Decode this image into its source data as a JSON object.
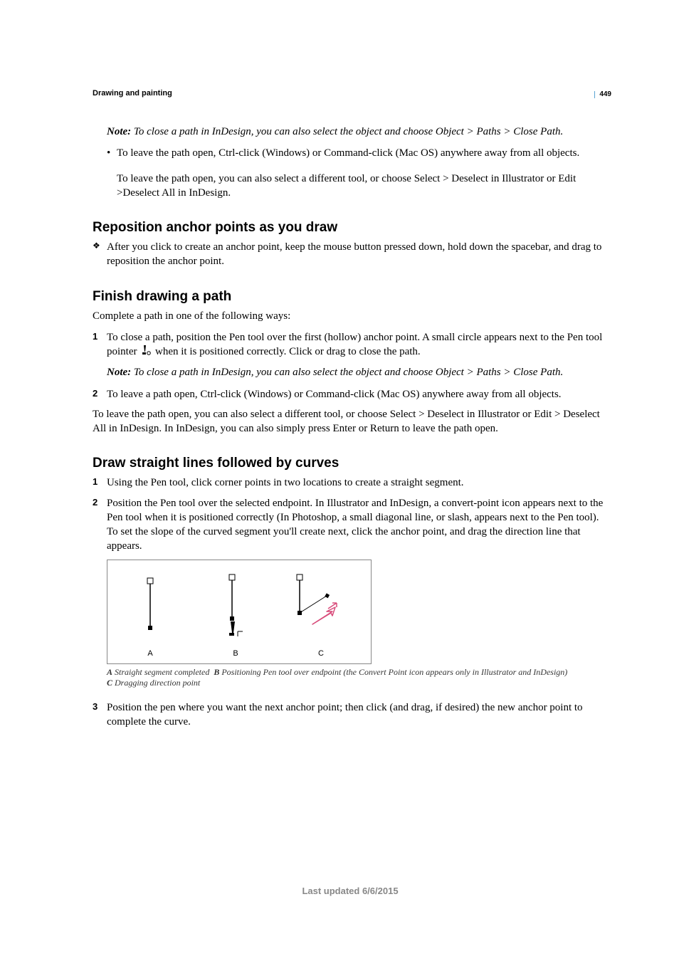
{
  "page_number": "449",
  "breadcrumb": "Drawing and painting",
  "intro_note": "To close a path in InDesign, you can also select the object and choose Object > Paths > Close Path.",
  "note_label": "Note: ",
  "bullet1": "To leave the path open, Ctrl-click (Windows) or Command-click (Mac OS) anywhere away from all objects.",
  "bullet1_sub": "To leave the path open, you can also select a different tool, or choose Select > Deselect in Illustrator or Edit >Deselect All in InDesign.",
  "sec1": {
    "title": "Reposition anchor points as you draw",
    "item": "After you click to create an anchor point, keep the mouse button pressed down, hold down the spacebar, and drag to reposition the anchor point."
  },
  "sec2": {
    "title": "Finish drawing a path",
    "intro": "Complete a path in one of the following ways:",
    "step1a": "To close a path, position the Pen tool over the first (hollow) anchor point. A small circle appears next to the Pen tool pointer ",
    "step1b": " when it is positioned correctly. Click or drag to close the path.",
    "note": "To close a path in InDesign, you can also select the object and choose Object > Paths > Close Path.",
    "step2": "To leave a path open, Ctrl-click (Windows) or Command-click (Mac OS) anywhere away from all objects.",
    "tail": "To leave the path open, you can also select a different tool, or choose Select > Deselect in Illustrator or Edit > Deselect All in InDesign. In InDesign, you can also simply press Enter or Return to leave the path open."
  },
  "sec3": {
    "title": "Draw straight lines followed by curves",
    "step1": "Using the Pen tool, click corner points in two locations to create a straight segment.",
    "step2": "Position the Pen tool over the selected endpoint. In Illustrator and InDesign, a convert-point icon appears next to the Pen tool when it is positioned correctly (In Photoshop, a small diagonal line, or slash, appears next to the Pen tool). To set the slope of the curved segment you'll create next, click the anchor point, and drag the direction line that appears.",
    "fig_labels": {
      "a": "A",
      "b": "B",
      "c": "C"
    },
    "caption_a": "Straight segment completed",
    "caption_b": "Positioning Pen tool over endpoint (the Convert Point icon appears only in Illustrator and InDesign)",
    "caption_c": "Dragging direction point",
    "step3": "Position the pen where you want the next anchor point; then click (and drag, if desired) the new anchor point to complete the curve."
  },
  "footer": "Last updated 6/6/2015"
}
